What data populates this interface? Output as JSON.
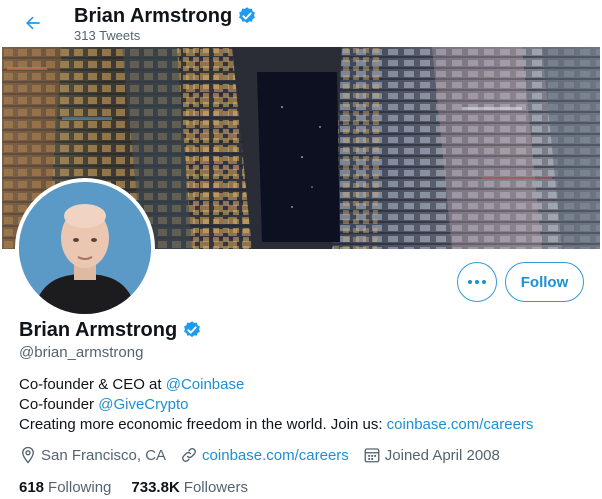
{
  "header": {
    "name": "Brian Armstrong",
    "tweet_count": "313 Tweets"
  },
  "profile": {
    "name": "Brian Armstrong",
    "handle": "@brian_armstrong",
    "follow_label": "Follow",
    "more_label": "•••",
    "bio": {
      "line1_text": "Co-founder & CEO at ",
      "line1_link": "@Coinbase",
      "line2_text": "Co-founder ",
      "line2_link": "@GiveCrypto",
      "line3_text": "Creating more economic freedom in the world. Join us: ",
      "line3_link": "coinbase.com/careers"
    },
    "location": "San Francisco, CA",
    "website": "coinbase.com/careers",
    "joined": "Joined April 2008",
    "following_count": "618",
    "following_label": "Following",
    "followers_count": "733.8K",
    "followers_label": "Followers"
  },
  "colors": {
    "accent": "#1d9bf0",
    "verified": "#1d9bf0"
  },
  "icons": [
    "back-arrow-icon",
    "verified-badge-icon",
    "location-icon",
    "link-icon",
    "calendar-icon",
    "more-icon"
  ]
}
